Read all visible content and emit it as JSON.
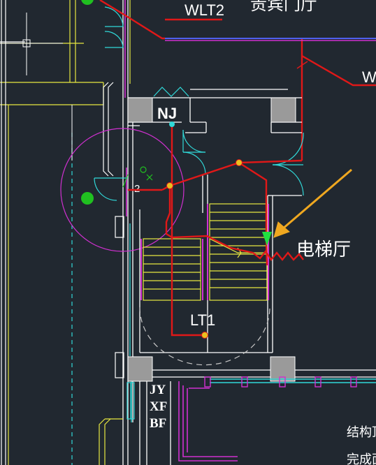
{
  "title_partial": "贵宾门厅",
  "circuit_labels": {
    "wlt2": "WLT2",
    "w_partial": "W",
    "nj": "NJ",
    "lt1": "LT1"
  },
  "callout": {
    "text": "电梯厅",
    "arrow_color": "#F0A820"
  },
  "marker_number": "2",
  "shaft_labels": [
    "JY",
    "XF",
    "BF"
  ],
  "right_notes": [
    "结构顶",
    "完成面"
  ],
  "colors": {
    "background": "#212830",
    "wiring": "#E01818",
    "walls": "#FFFFFF",
    "doors": "#30D8D8",
    "stairs": "#E8E840",
    "magenta": "#D030D0",
    "blue_line": "#5060F0"
  }
}
